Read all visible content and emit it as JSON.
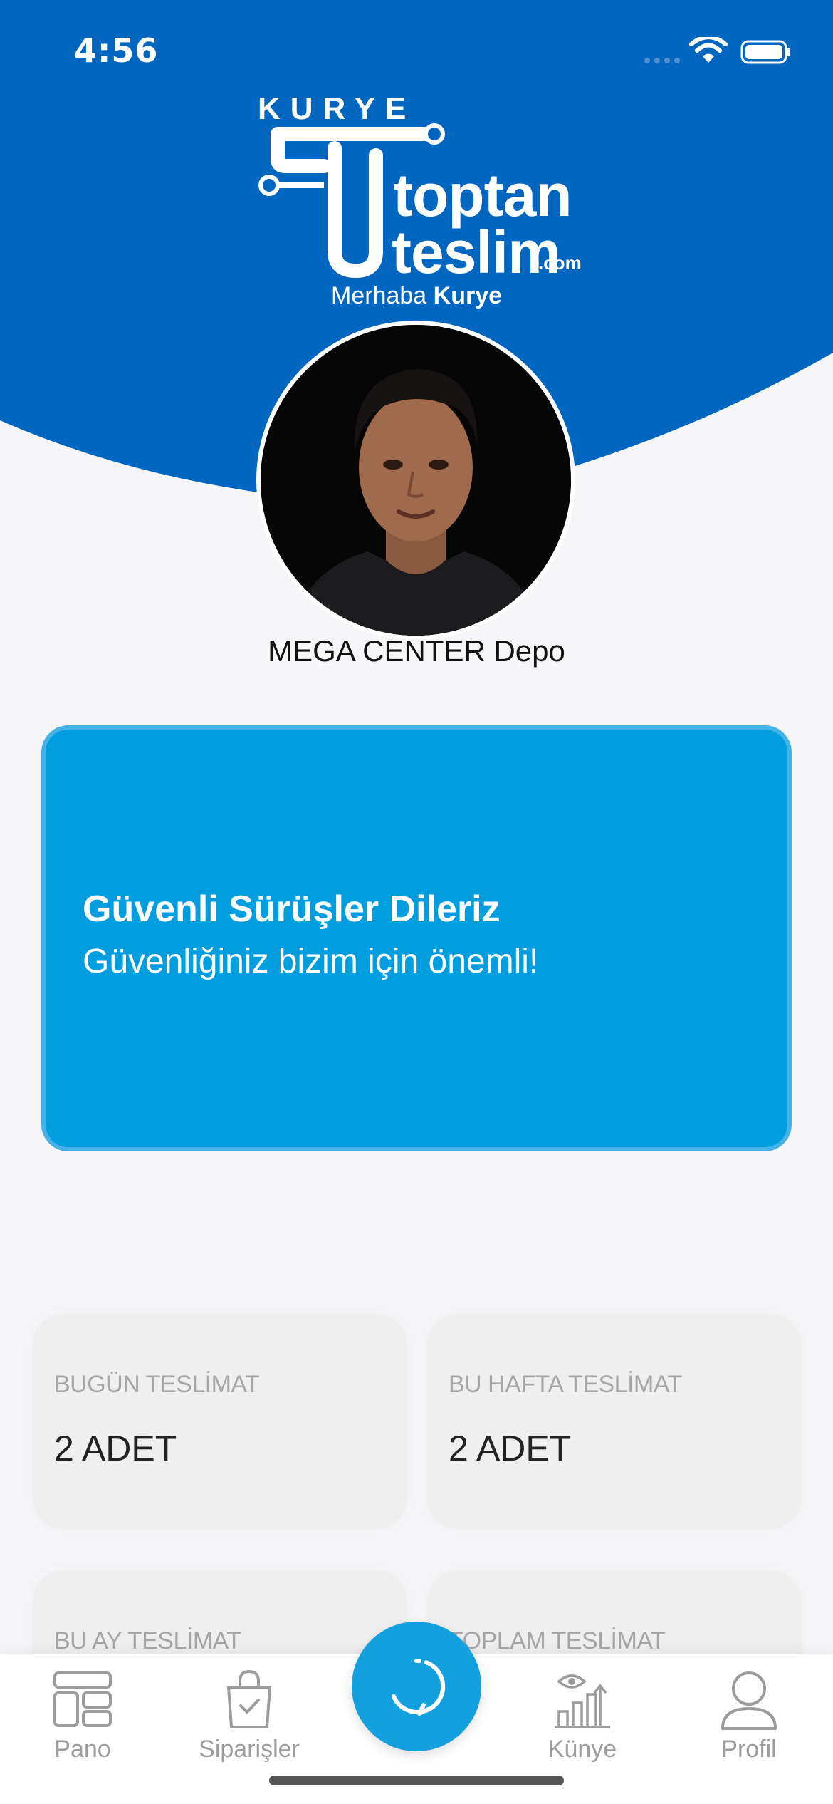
{
  "status_bar": {
    "time": "4:56"
  },
  "brand": {
    "top_word": "KURYE",
    "line1": "toptan",
    "line2": "teslim",
    "suffix": ".com"
  },
  "greeting": {
    "prefix": "Merhaba",
    "name": "Kurye"
  },
  "profile": {
    "store_name": "MEGA CENTER Depo"
  },
  "banner": {
    "title": "Güvenli Sürüşler Dileriz",
    "subtitle": "Güvenliğiniz bizim için önemli!"
  },
  "stats": [
    {
      "label": "BUGÜN TESLİMAT",
      "value": "2 ADET"
    },
    {
      "label": "BU HAFTA TESLİMAT",
      "value": "2 ADET"
    },
    {
      "label": "BU AY TESLİMAT",
      "value": ""
    },
    {
      "label": "TOPLAM TESLİMAT",
      "value": ""
    }
  ],
  "tabs": [
    {
      "label": "Pano",
      "icon": "dashboard-icon"
    },
    {
      "label": "Siparişler",
      "icon": "shopping-bag-check-icon"
    },
    {
      "label": "",
      "icon": "refresh-icon"
    },
    {
      "label": "Künye",
      "icon": "chart-eye-icon"
    },
    {
      "label": "Profil",
      "icon": "user-icon"
    }
  ],
  "colors": {
    "primary_blue": "#0066bf",
    "banner_blue": "#009ddf",
    "fab_blue": "#12a0de",
    "background": "#f6f6f8",
    "card_bg": "#efefef",
    "tab_inactive": "#9c9c9c"
  }
}
